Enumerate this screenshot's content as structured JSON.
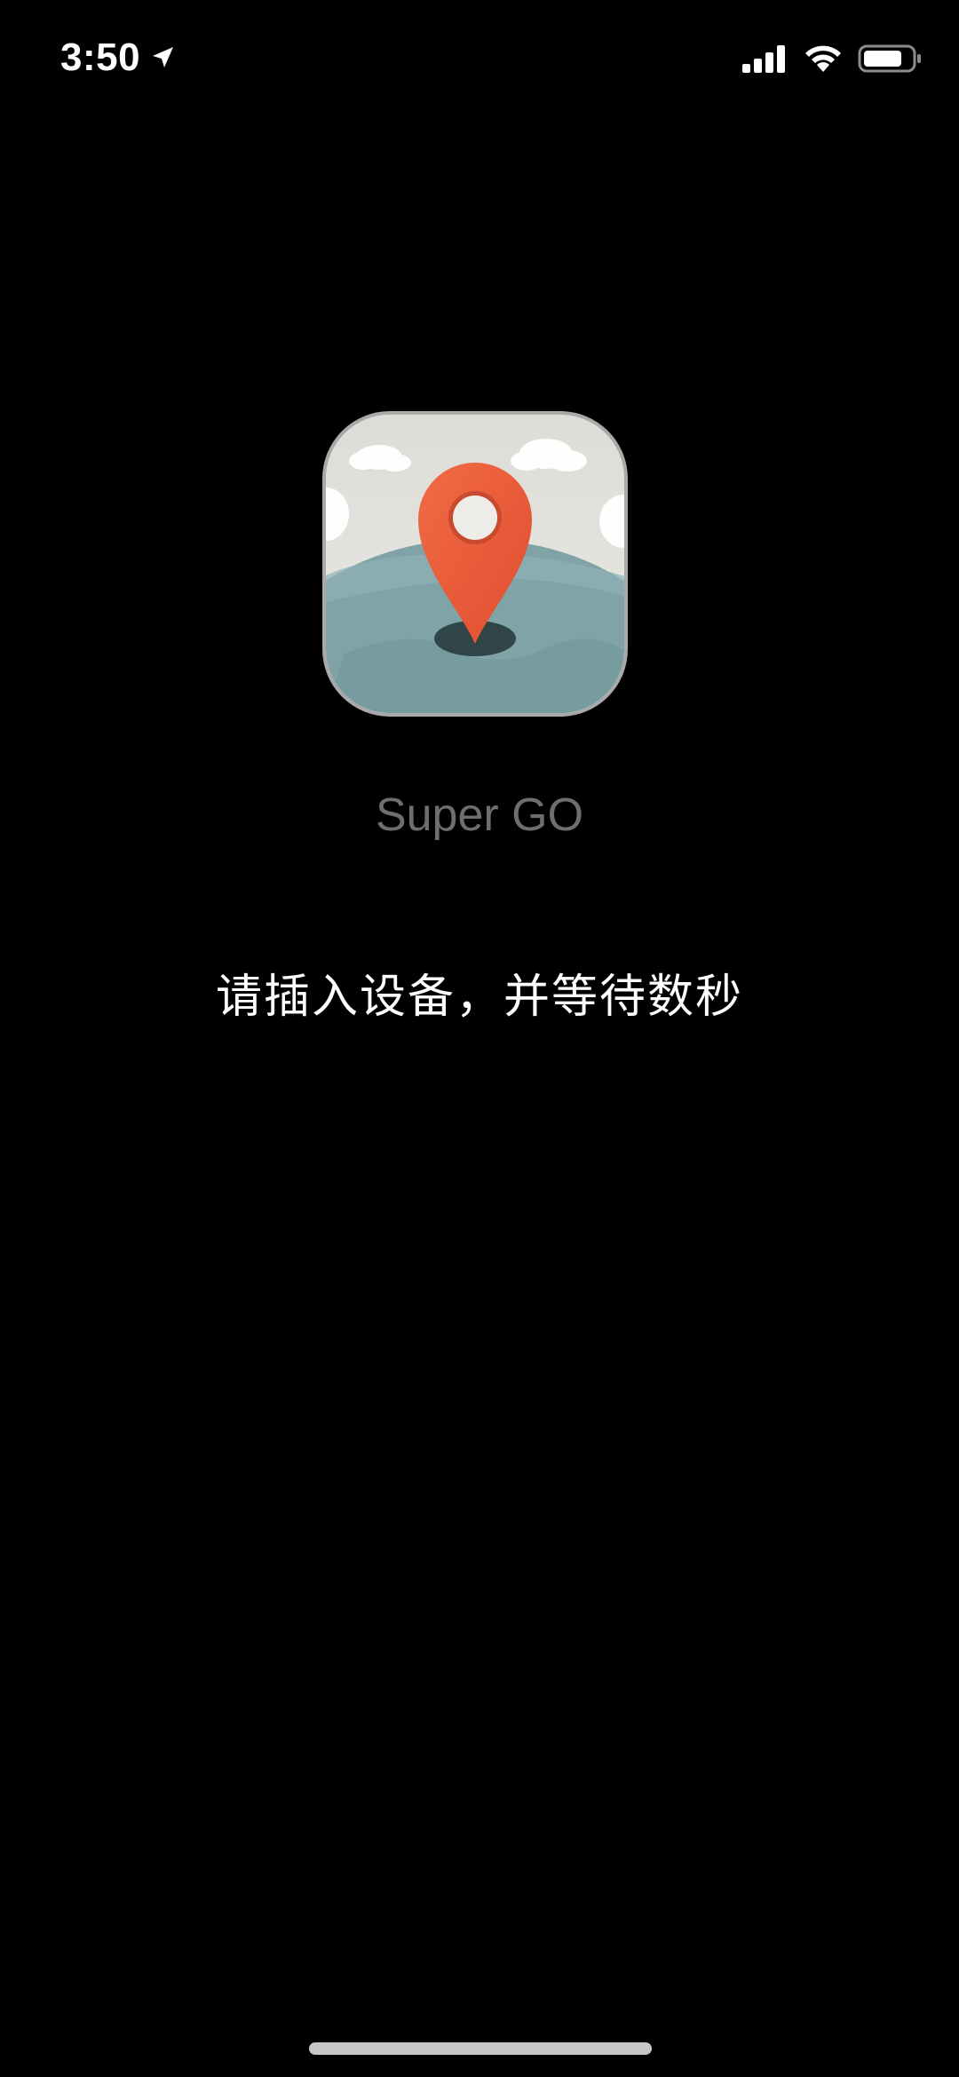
{
  "status_bar": {
    "time": "3:50",
    "icons": [
      "location-arrow-icon",
      "cellular-signal-icon",
      "wifi-icon",
      "battery-icon"
    ]
  },
  "app": {
    "name": "Super GO",
    "icon": "map-pin-globe-icon"
  },
  "instruction": "请插入设备，并等待数秒",
  "colors": {
    "background": "#000000",
    "app_name_text": "#6e6e6e",
    "instruction_text": "#ffffff",
    "pin": "#ee5b3a",
    "globe": "#7fa4a8",
    "home_indicator": "#c6c6c6"
  }
}
